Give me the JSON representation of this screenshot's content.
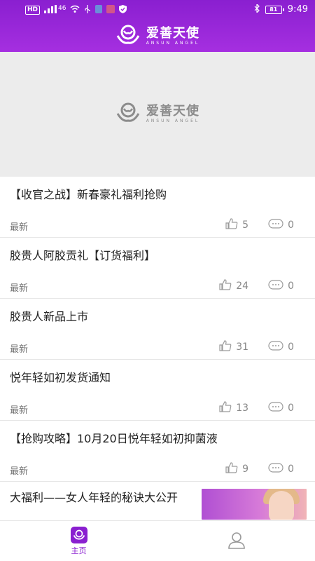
{
  "status_bar": {
    "left_chips": [
      "HD",
      "46"
    ],
    "battery": "81",
    "time": "9:49"
  },
  "app": {
    "brand_title": "爱善天使",
    "brand_subtitle": "ANSUN ANGEL"
  },
  "banner": {
    "brand_title": "爱善天使",
    "brand_subtitle": "ANSUN ANGEL"
  },
  "articles": [
    {
      "title": "【收官之战】新春豪礼福利抢购",
      "tag": "最新",
      "likes": "5",
      "comments": "0"
    },
    {
      "title": "胶贵人阿胶贡礼【订货福利】",
      "tag": "最新",
      "likes": "24",
      "comments": "0"
    },
    {
      "title": "胶贵人新品上市",
      "tag": "最新",
      "likes": "31",
      "comments": "0"
    },
    {
      "title": "悦年轻如初发货通知",
      "tag": "最新",
      "likes": "13",
      "comments": "0"
    },
    {
      "title": "【抢购攻略】10月20日悦年轻如初抑菌液",
      "tag": "最新",
      "likes": "9",
      "comments": "0"
    },
    {
      "title": "大福利——女人年轻的秘诀大公开"
    }
  ],
  "bottom_nav": {
    "home_label": "主页"
  },
  "colors": {
    "brand_purple": "#8a1fd0",
    "banner_gray": "#ececec"
  },
  "icons": {
    "like": "thumbs-up-icon",
    "comment": "comment-bubble-icon",
    "profile": "user-icon"
  }
}
